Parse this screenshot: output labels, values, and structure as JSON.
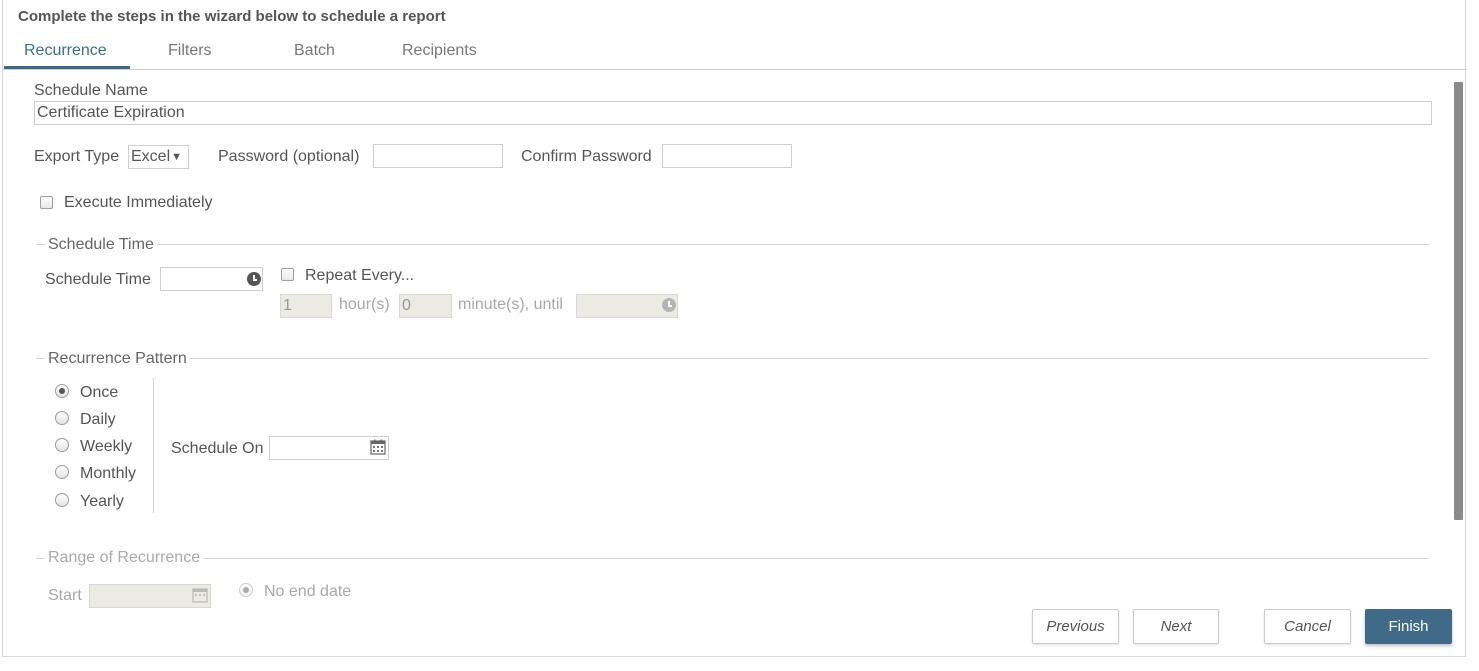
{
  "header": {
    "title": "Complete the steps in the wizard below to schedule a report"
  },
  "tabs": [
    {
      "label": "Recurrence",
      "active": true
    },
    {
      "label": "Filters",
      "active": false
    },
    {
      "label": "Batch",
      "active": false
    },
    {
      "label": "Recipients",
      "active": false
    }
  ],
  "schedule_name": {
    "label": "Schedule Name",
    "value": "Certificate Expiration"
  },
  "export": {
    "type_label": "Export Type",
    "type_value": "Excel",
    "password_label": "Password (optional)",
    "password_value": "",
    "confirm_label": "Confirm Password",
    "confirm_value": ""
  },
  "execute_immediately": {
    "label": "Execute Immediately",
    "checked": false
  },
  "schedule_time": {
    "legend": "Schedule Time",
    "label": "Schedule Time",
    "value": "",
    "repeat_label": "Repeat Every...",
    "repeat_checked": false,
    "hours_value": "1",
    "hours_label": "hour(s)",
    "minutes_value": "0",
    "minutes_label": "minute(s), until",
    "until_value": ""
  },
  "recurrence_pattern": {
    "legend": "Recurrence Pattern",
    "options": [
      {
        "label": "Once",
        "checked": true
      },
      {
        "label": "Daily",
        "checked": false
      },
      {
        "label": "Weekly",
        "checked": false
      },
      {
        "label": "Monthly",
        "checked": false
      },
      {
        "label": "Yearly",
        "checked": false
      }
    ],
    "schedule_on_label": "Schedule On",
    "schedule_on_value": ""
  },
  "range_of_recurrence": {
    "legend": "Range of Recurrence",
    "start_label": "Start",
    "start_value": "",
    "no_end_label": "No end date"
  },
  "buttons": {
    "previous": "Previous",
    "next": "Next",
    "cancel": "Cancel",
    "finish": "Finish"
  },
  "colors": {
    "accent": "#3f6b89",
    "text": "#555555",
    "border": "#cfcfcf",
    "disabled_bg": "#ebebe4"
  }
}
